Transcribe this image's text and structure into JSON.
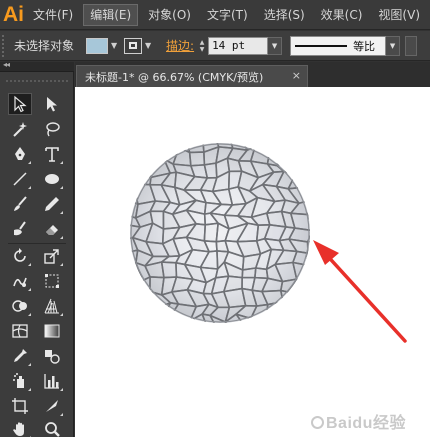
{
  "app": {
    "logo": "Ai",
    "brand_color": "#f79a1e"
  },
  "menu": [
    {
      "label": "文件(F)",
      "active": false
    },
    {
      "label": "编辑(E)",
      "active": true
    },
    {
      "label": "对象(O)",
      "active": false
    },
    {
      "label": "文字(T)",
      "active": false
    },
    {
      "label": "选择(S)",
      "active": false
    },
    {
      "label": "效果(C)",
      "active": false
    },
    {
      "label": "视图(V)",
      "active": false
    }
  ],
  "control": {
    "selection_label": "未选择对象",
    "fill_color": "#a7c7d9",
    "stroke_label": "描边:",
    "stroke_weight": "14 pt",
    "profile_label": "等比"
  },
  "tab": {
    "title": "未标题-1* @ 66.67% (CMYK/预览)",
    "close": "×"
  },
  "toolbox": {
    "tools": [
      "selection-tool",
      "direct-selection-tool",
      "magic-wand-tool",
      "lasso-tool",
      "pen-tool",
      "type-tool",
      "line-segment-tool",
      "ellipse-tool",
      "paintbrush-tool",
      "pencil-tool",
      "blob-brush-tool",
      "eraser-tool",
      "rotate-tool",
      "scale-tool",
      "warp-tool",
      "free-transform-tool",
      "shape-builder-tool",
      "perspective-grid-tool",
      "mesh-tool",
      "gradient-tool",
      "eyedropper-tool",
      "blend-tool",
      "symbol-sprayer-tool",
      "column-graph-tool",
      "artboard-tool",
      "slice-tool",
      "hand-tool",
      "zoom-tool"
    ]
  },
  "watermark": "Baidu经验",
  "annotation_color": "#e8302a"
}
